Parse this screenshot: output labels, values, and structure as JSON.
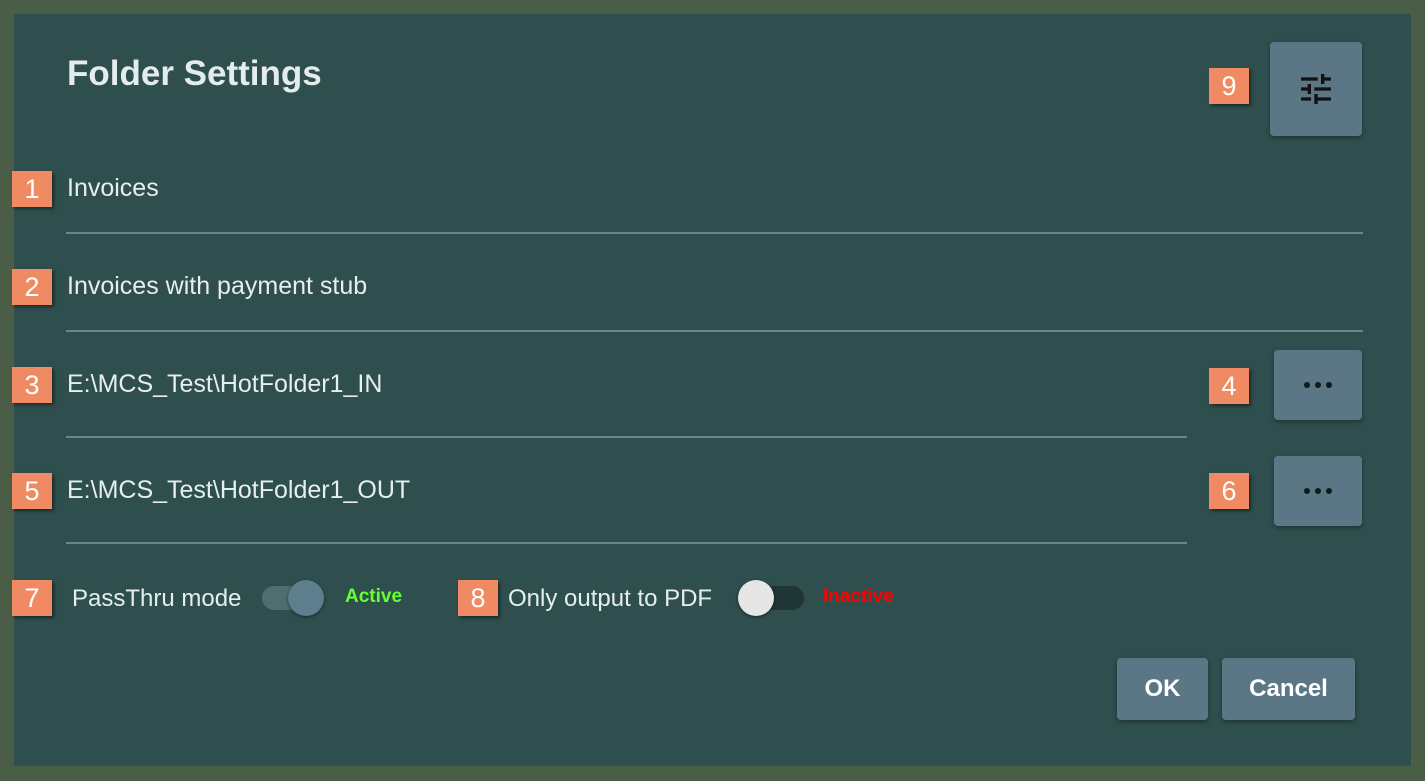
{
  "dialog": {
    "title": "Folder Settings",
    "fields": {
      "name": "Invoices",
      "description": "Invoices with payment stub",
      "input_folder": "E:\\MCS_Test\\HotFolder1_IN",
      "output_folder": "E:\\MCS_Test\\HotFolder1_OUT"
    },
    "toggles": {
      "passthru": {
        "label": "PassThru mode",
        "state": "Active",
        "on": true,
        "color": "#66ff33"
      },
      "pdf_only": {
        "label": "Only output to PDF",
        "state": "Inactive",
        "on": false,
        "color": "#ff0000"
      }
    },
    "buttons": {
      "ok": "OK",
      "cancel": "Cancel"
    },
    "icons": {
      "settings": "tune-sliders-icon",
      "browse": "more-horizontal-icon"
    }
  },
  "badges": [
    "1",
    "2",
    "3",
    "4",
    "5",
    "6",
    "7",
    "8",
    "9"
  ]
}
